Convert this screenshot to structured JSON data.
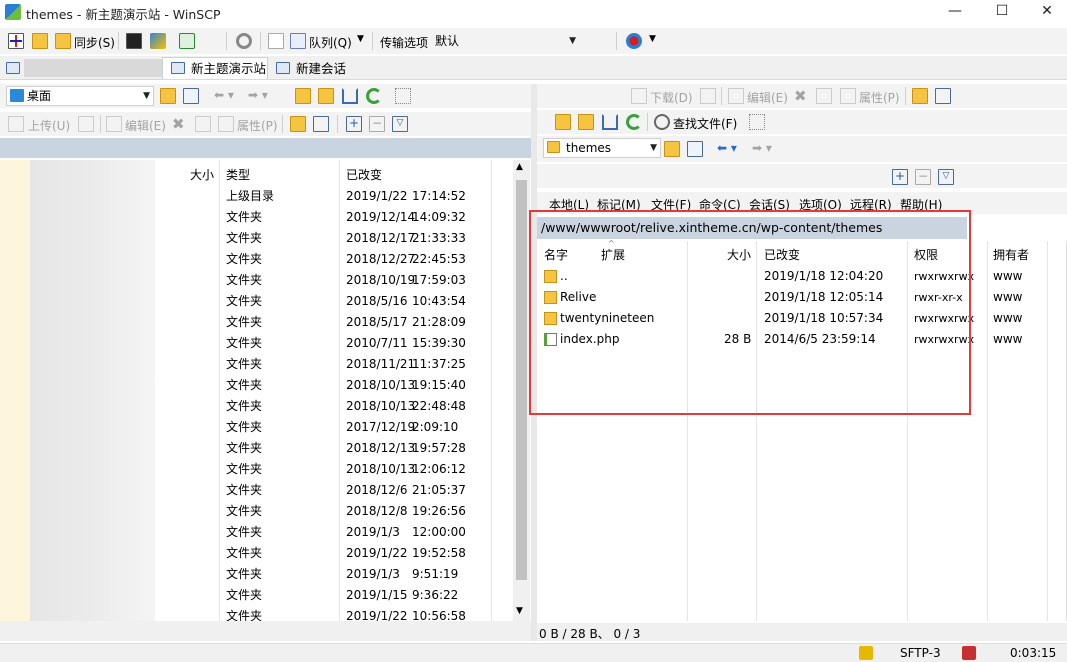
{
  "window": {
    "title": "themes - 新主题演示站 - WinSCP",
    "controls": {
      "minimize": "—",
      "maximize": "☐",
      "close": "✕"
    }
  },
  "toolbar_main": {
    "sync": "同步(S)",
    "queue": "队列(Q)",
    "transfer_label": "传输选项",
    "transfer_value": "默认"
  },
  "tabs": [
    {
      "label": "新主题演示站",
      "active": true
    },
    {
      "label": "新建会话",
      "active": false
    }
  ],
  "left_panel": {
    "location": "桌面",
    "toolbar": {
      "upload": "上传(U)",
      "edit": "编辑(E)",
      "properties": "属性(P)"
    },
    "columns": {
      "size": "大小",
      "type": "类型",
      "changed": "已改变"
    },
    "rows": [
      {
        "type": "上级目录",
        "date": "2019/1/22",
        "time": "17:14:52"
      },
      {
        "type": "文件夹",
        "date": "2019/12/14",
        "time": "14:09:32"
      },
      {
        "type": "文件夹",
        "date": "2018/12/17",
        "time": "21:33:33"
      },
      {
        "type": "文件夹",
        "date": "2018/12/27",
        "time": "22:45:53"
      },
      {
        "type": "文件夹",
        "date": "2018/10/19",
        "time": "17:59:03"
      },
      {
        "type": "文件夹",
        "date": "2018/5/16",
        "time": "10:43:54"
      },
      {
        "type": "文件夹",
        "date": "2018/5/17",
        "time": "21:28:09"
      },
      {
        "type": "文件夹",
        "date": "2010/7/11",
        "time": "15:39:30"
      },
      {
        "type": "文件夹",
        "date": "2018/11/21",
        "time": "11:37:25"
      },
      {
        "type": "文件夹",
        "date": "2018/10/13",
        "time": "19:15:40"
      },
      {
        "type": "文件夹",
        "date": "2018/10/13",
        "time": "22:48:48"
      },
      {
        "type": "文件夹",
        "date": "2017/12/19",
        "time": "2:09:10"
      },
      {
        "type": "文件夹",
        "date": "2018/12/13",
        "time": "19:57:28"
      },
      {
        "type": "文件夹",
        "date": "2018/10/13",
        "time": "12:06:12"
      },
      {
        "type": "文件夹",
        "date": "2018/12/6",
        "time": "21:05:37"
      },
      {
        "type": "文件夹",
        "date": "2018/12/8",
        "time": "19:26:56"
      },
      {
        "type": "文件夹",
        "date": "2019/1/3",
        "time": "12:00:00"
      },
      {
        "type": "文件夹",
        "date": "2019/1/22",
        "time": "19:52:58"
      },
      {
        "type": "文件夹",
        "date": "2019/1/3",
        "time": "9:51:19"
      },
      {
        "type": "文件夹",
        "date": "2019/1/15",
        "time": "9:36:22"
      },
      {
        "type": "文件夹",
        "date": "2019/1/22",
        "time": "10:56:58"
      }
    ]
  },
  "right_panel": {
    "toolbar": {
      "download": "下载(D)",
      "edit": "编辑(E)",
      "properties": "属性(P)",
      "find": "查找文件(F)"
    },
    "location": "themes",
    "menu": [
      "本地(L)",
      "标记(M)",
      "文件(F)",
      "命令(C)",
      "会话(S)",
      "选项(O)",
      "远程(R)",
      "帮助(H)"
    ],
    "path": "/www/wwwroot/relive.xintheme.cn/wp-content/themes",
    "columns": {
      "name": "名字",
      "ext": "扩展",
      "size": "大小",
      "changed": "已改变",
      "rights": "权限",
      "owner": "拥有者"
    },
    "rows": [
      {
        "name": "..",
        "size": "",
        "changed": "2019/1/18 12:04:20",
        "rights": "rwxrwxrwx",
        "owner": "www",
        "icon": "parent-dir-icon"
      },
      {
        "name": "Relive",
        "size": "",
        "changed": "2019/1/18 12:05:14",
        "rights": "rwxr-xr-x",
        "owner": "www",
        "icon": "folder-icon"
      },
      {
        "name": "twentynineteen",
        "size": "",
        "changed": "2019/1/18 10:57:34",
        "rights": "rwxrwxrwx",
        "owner": "www",
        "icon": "folder-icon"
      },
      {
        "name": "index.php",
        "size": "28 B",
        "changed": "2014/6/5 23:59:14",
        "rights": "rwxrwxrwx",
        "owner": "www",
        "icon": "php-file-icon"
      }
    ]
  },
  "statusbar": {
    "selection": "0 B / 28 B、 0 / 3",
    "protocol": "SFTP-3",
    "elapsed": "0:03:15"
  },
  "colors": {
    "path_bar": "#c9d4e0",
    "highlight": "#e03a3a",
    "folder": "#f5c542"
  }
}
